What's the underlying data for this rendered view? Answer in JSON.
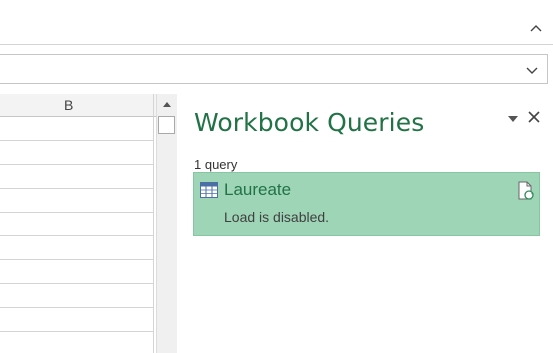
{
  "grid": {
    "column_header": "B",
    "row_count": 10
  },
  "workbook_queries": {
    "title": "Workbook Queries",
    "query_count": "1 query",
    "queries": [
      {
        "name": "Laureate",
        "status": "Load is disabled."
      }
    ]
  },
  "icons": {
    "ribbon_collapse": "chevron-up-icon",
    "formula_expand": "chevron-down-icon",
    "scroll_up": "triangle-up-icon",
    "pane_menu": "triangle-down-icon",
    "pane_close": "close-icon",
    "query_table": "table-icon",
    "query_refresh": "refresh-document-icon"
  },
  "colors": {
    "accent_green": "#217346",
    "query_card_bg": "#9fd5b7",
    "gridline": "#d4d4d4"
  }
}
